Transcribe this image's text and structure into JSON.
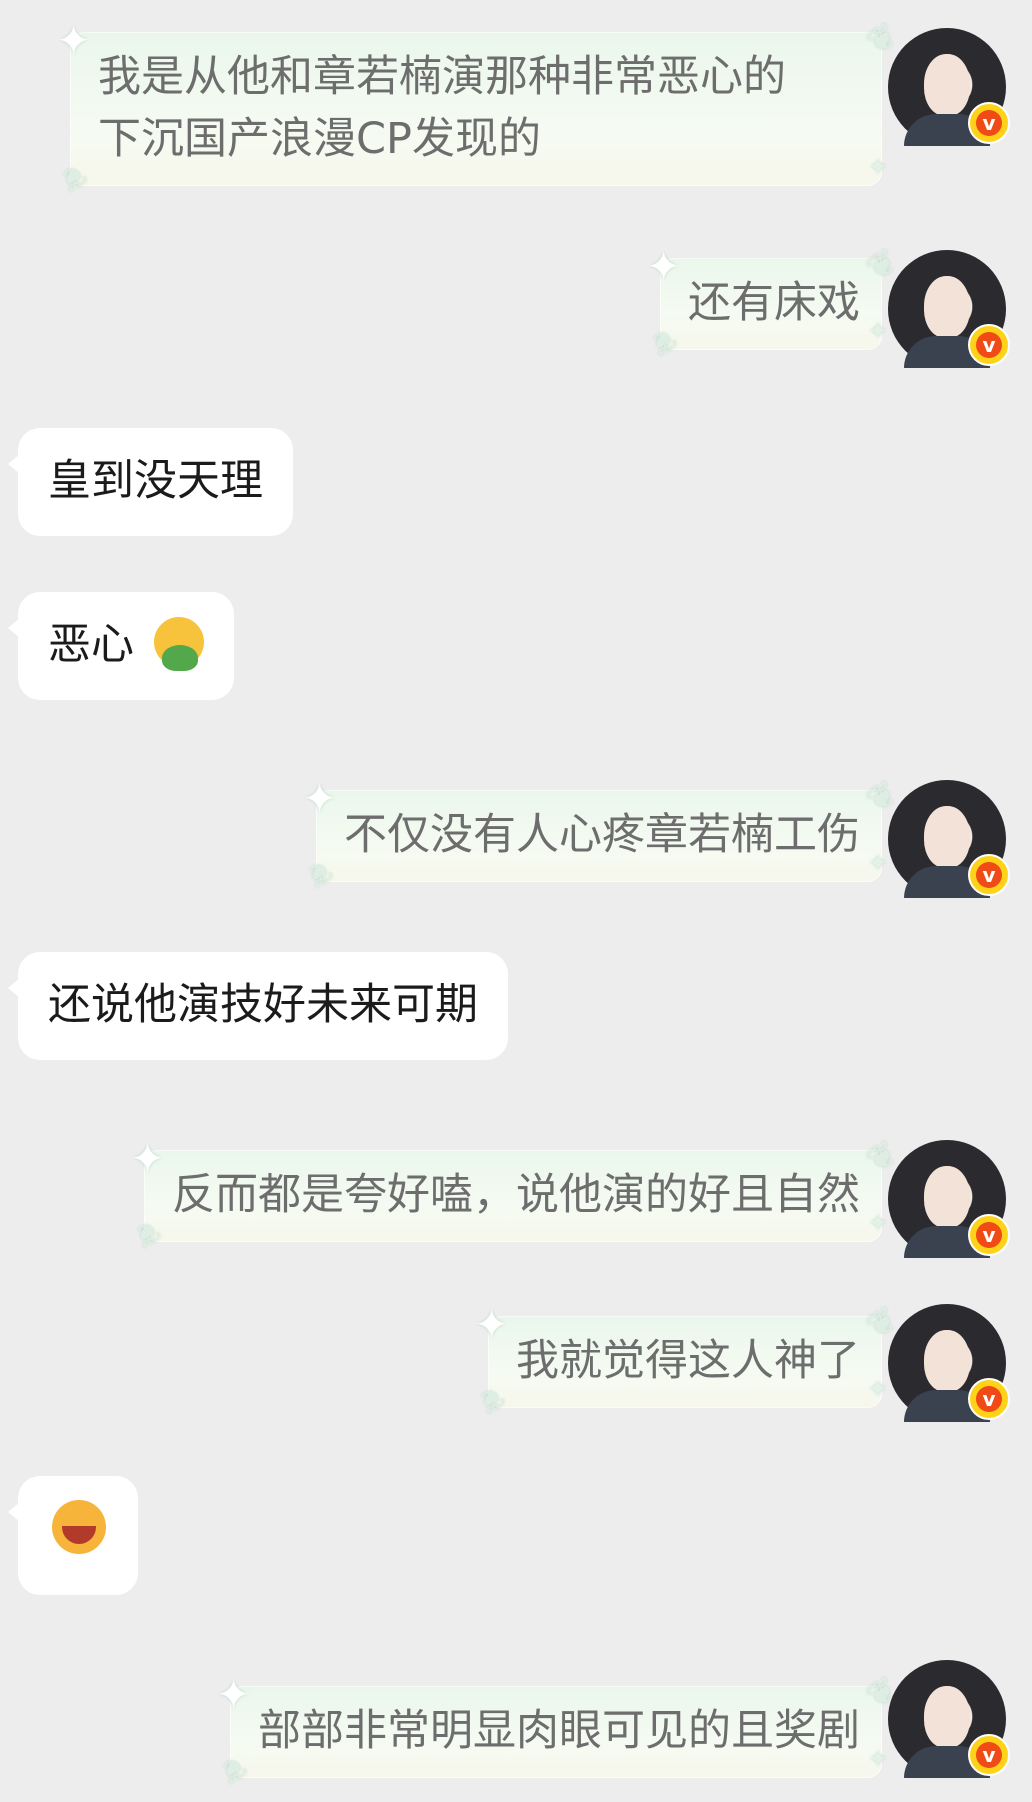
{
  "messages": [
    {
      "side": "self",
      "text": "我是从他和章若楠演那种非常恶心的\n下沉国产浪漫CP发现的",
      "avatar": "user-avatar",
      "badge": "v-badge"
    },
    {
      "side": "self",
      "text": "还有床戏",
      "avatar": "user-avatar",
      "badge": "v-badge"
    },
    {
      "side": "other",
      "text": "皇到没天理"
    },
    {
      "side": "other",
      "text": "恶心",
      "emoji": "vomiting-face-emoji"
    },
    {
      "side": "self",
      "text": "不仅没有人心疼章若楠工伤",
      "avatar": "user-avatar",
      "badge": "v-badge"
    },
    {
      "side": "other",
      "text": "还说他演技好未来可期"
    },
    {
      "side": "self",
      "text": "反而都是夸好嗑，说他演的好且自然",
      "avatar": "user-avatar",
      "badge": "v-badge"
    },
    {
      "side": "self",
      "text": "我就觉得这人神了",
      "avatar": "user-avatar",
      "badge": "v-badge"
    },
    {
      "side": "other",
      "text": "",
      "emoji": "laughing-face-emoji"
    },
    {
      "side": "self",
      "text": "部部非常明显肉眼可见的且奖剧",
      "avatar": "user-avatar",
      "badge": "v-badge"
    }
  ],
  "badge_letter": "v",
  "colors": {
    "background": "#ededed",
    "bubble_other": "#ffffff",
    "bubble_self_text": "#6d6d6d",
    "badge_yellow": "#ffd21a",
    "badge_red": "#f04a16"
  }
}
